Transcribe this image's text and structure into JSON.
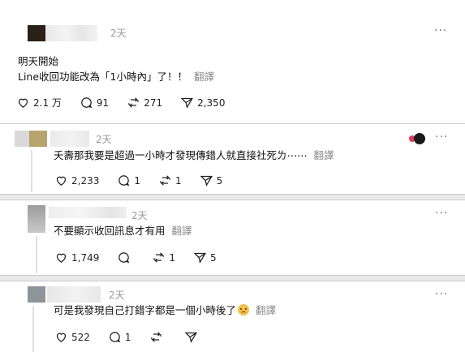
{
  "main_post": {
    "time": "2天",
    "line1": "明天開始",
    "line2": "Line收回功能改為「1小時內」了！！",
    "translate": "翻譯",
    "likes": "2.1 万",
    "comments": "91",
    "reposts": "271",
    "shares": "2,350",
    "more": "···"
  },
  "replies": [
    {
      "time": "2天",
      "text": "夭壽那我要是超過一小時才發現傳錯人就直接社死ㄌ⋯⋯",
      "translate": "翻譯",
      "likes": "2,233",
      "comments": "1",
      "reposts": "1",
      "shares": "5",
      "more": "···"
    },
    {
      "time": "2天",
      "text": "不要顯示收回訊息才有用",
      "translate": "翻譯",
      "likes": "1,749",
      "comments": "",
      "reposts": "1",
      "shares": "5",
      "more": "···"
    },
    {
      "time": "2天",
      "text": "可是我發現自己打錯字都是一個小時後了",
      "translate": "翻譯",
      "likes": "522",
      "comments": "1",
      "reposts": "",
      "shares": "",
      "more": "···"
    }
  ],
  "icons": {
    "like": "heart-icon",
    "comment": "comment-icon",
    "repost": "repost-icon",
    "share": "share-icon",
    "more": "more-icon",
    "emoji": "sad-face-emoji-icon"
  }
}
